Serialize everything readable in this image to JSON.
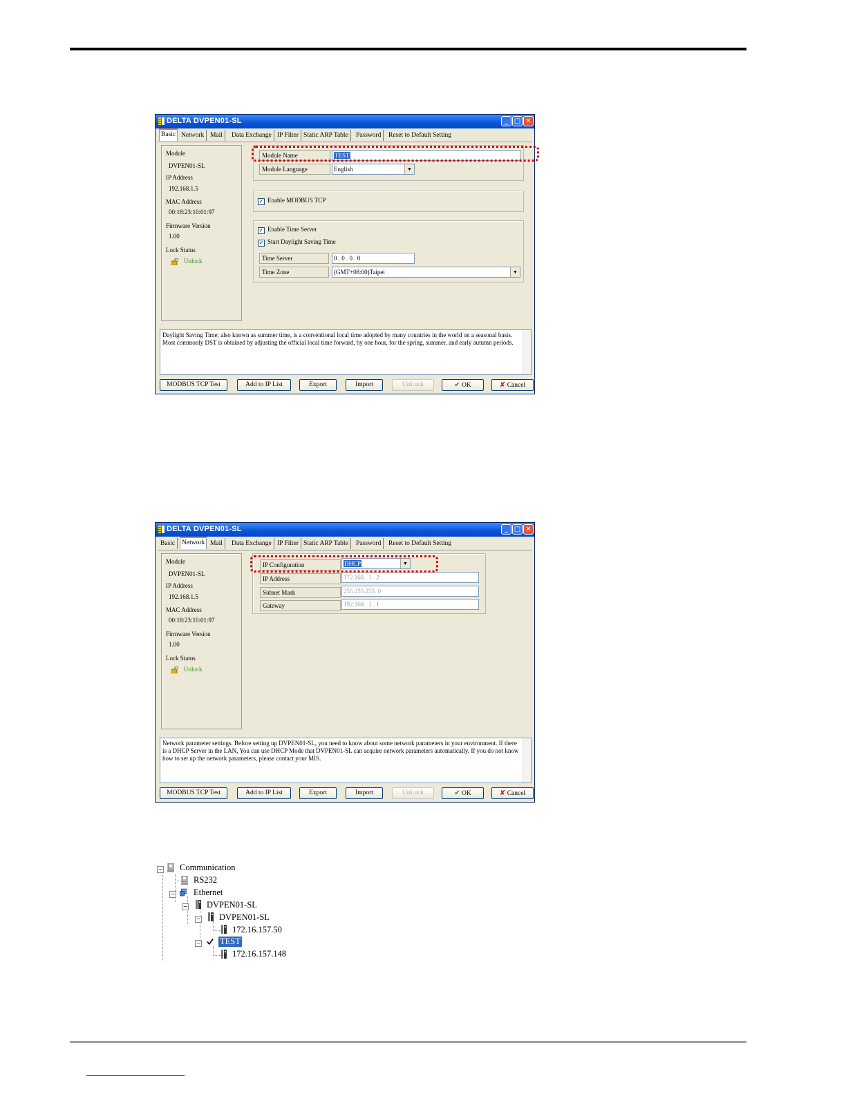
{
  "window": {
    "title": "DELTA DVPEN01-SL",
    "tabs": [
      "Basic",
      "Network",
      "Mail",
      "Data Exchange",
      "IP Filter",
      "Static ARP Table",
      "Password",
      "Reset to Default Setting"
    ]
  },
  "info_panel": {
    "module_label": "Module",
    "module_value": "DVPEN01-SL",
    "ip_label": "IP Address",
    "ip_value": "192.168.1.5",
    "mac_label": "MAC Address",
    "mac_value": "00:18:23:10:01:97",
    "firmware_label": "Firmware Version",
    "firmware_value": "1.00",
    "lock_label": "Lock Status",
    "lock_value": "Unlock"
  },
  "basic": {
    "module_name_label": "Module Name",
    "module_name_value": "TEST",
    "module_language_label": "Module Language",
    "module_language_value": "English",
    "enable_modbus": "Enable MODBUS TCP",
    "enable_time_server": "Enable Time Server",
    "start_dst": "Start Daylight Saving Time",
    "time_server_label": "Time Server",
    "time_server_value": "0 . 0 . 0 . 0",
    "time_zone_label": "Time Zone",
    "time_zone_value": "(GMT+08:00)Taipei",
    "description": "Daylight Saving Time; also known as summer time, is a conventional local time adopted by many countries in the world on a seasonal basis. Most commonly DST is obtained by adjusting the official local time forward, by one hour, for the spring, summer, and early autumn periods."
  },
  "network": {
    "ip_config_label": "IP Configuration",
    "ip_config_value": "DHCP",
    "ip_address_label": "IP Address",
    "ip_address_value": "172.168 . 1 . 2",
    "subnet_label": "Subnet Mask",
    "subnet_value": "255.255.255. 0",
    "gateway_label": "Gateway",
    "gateway_value": "192.168 . 1 . 1",
    "description": "Network parameter settings. Before setting up DVPEN01-SL, you need to know about some network parameters in your environment. If there is a DHCP Server in the LAN, You can use DHCP Mode that DVPEN01-SL can acquire network parameters automatically. If you do not know how to set up the network parameters, please contact your MIS."
  },
  "buttons": {
    "modbus_test": "MODBUS TCP Test",
    "add_ip": "Add to IP List",
    "export": "Export",
    "import": "Import",
    "unlock": "UnLock",
    "ok": "OK",
    "cancel": "Cancel"
  },
  "tree": {
    "communication": "Communication",
    "rs232": "RS232",
    "ethernet": "Ethernet",
    "dvpen_group": "DVPEN01-SL",
    "dvpen_module": "DVPEN01-SL",
    "ip1": "172.16.157.50",
    "test": "TEST",
    "ip2": "172.16.157.148"
  },
  "colors": {
    "titlebar": "#0954d8",
    "highlight": "#316ac5",
    "dotted_marker": "#d40000",
    "unlock_text": "#3a8a2a"
  },
  "icons": [
    "app-icon",
    "minimize-icon",
    "maximize-icon",
    "close-icon",
    "lock-open-icon",
    "checkmark-icon",
    "x-icon",
    "dropdown-arrow-icon",
    "tree-computer-icon",
    "tree-network-icon",
    "tree-module-icon",
    "tree-check-icon"
  ]
}
